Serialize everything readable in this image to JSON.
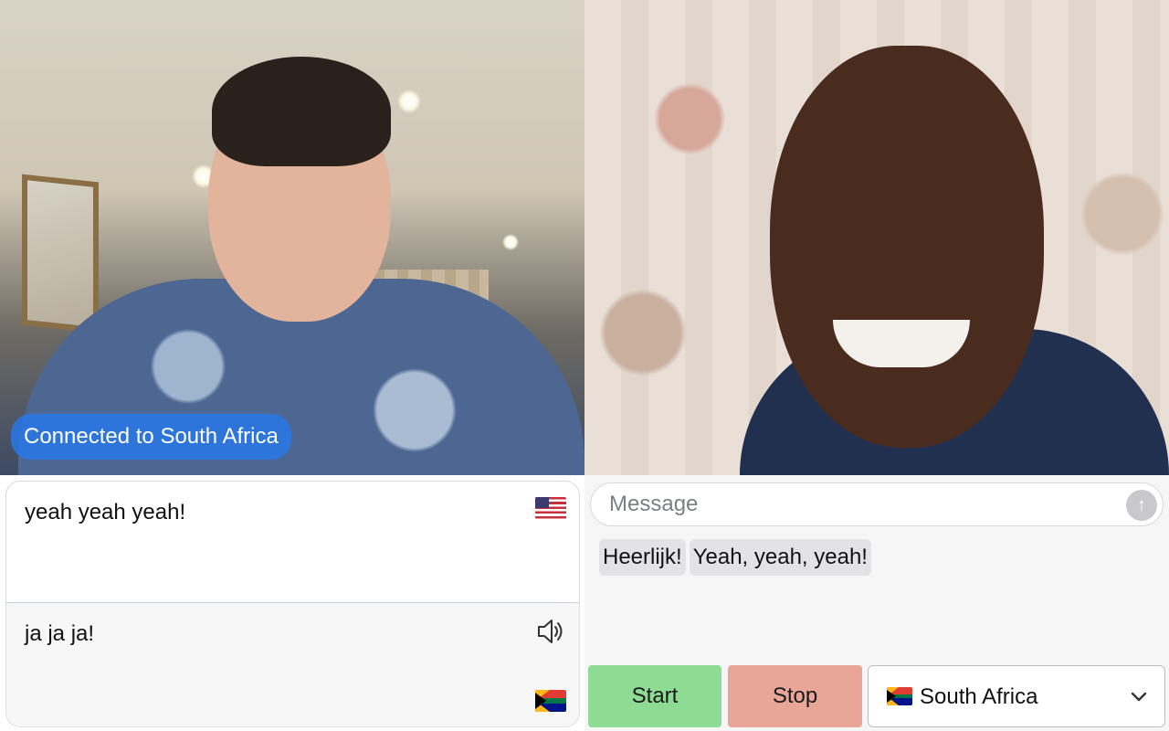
{
  "video": {
    "connected_badge": "Connected to South Africa"
  },
  "transcript": {
    "source_text": "yeah yeah yeah!",
    "source_flag_icon": "us-flag-icon",
    "target_text": "ja ja ja!",
    "target_flag_icon": "south-africa-flag-icon",
    "speaker_icon": "speaker-icon"
  },
  "chat": {
    "message_placeholder": "Message",
    "send_icon": "arrow-up-icon",
    "messages": [
      "Heerlijk!",
      "Yeah, yeah, yeah!"
    ]
  },
  "controls": {
    "start_label": "Start",
    "stop_label": "Stop",
    "country_selected": "South Africa",
    "country_flag_icon": "south-africa-flag-icon",
    "chevron_icon": "chevron-down-icon"
  },
  "colors": {
    "badge": "#2878e6",
    "start": "#8edb94",
    "stop": "#e8a698"
  }
}
